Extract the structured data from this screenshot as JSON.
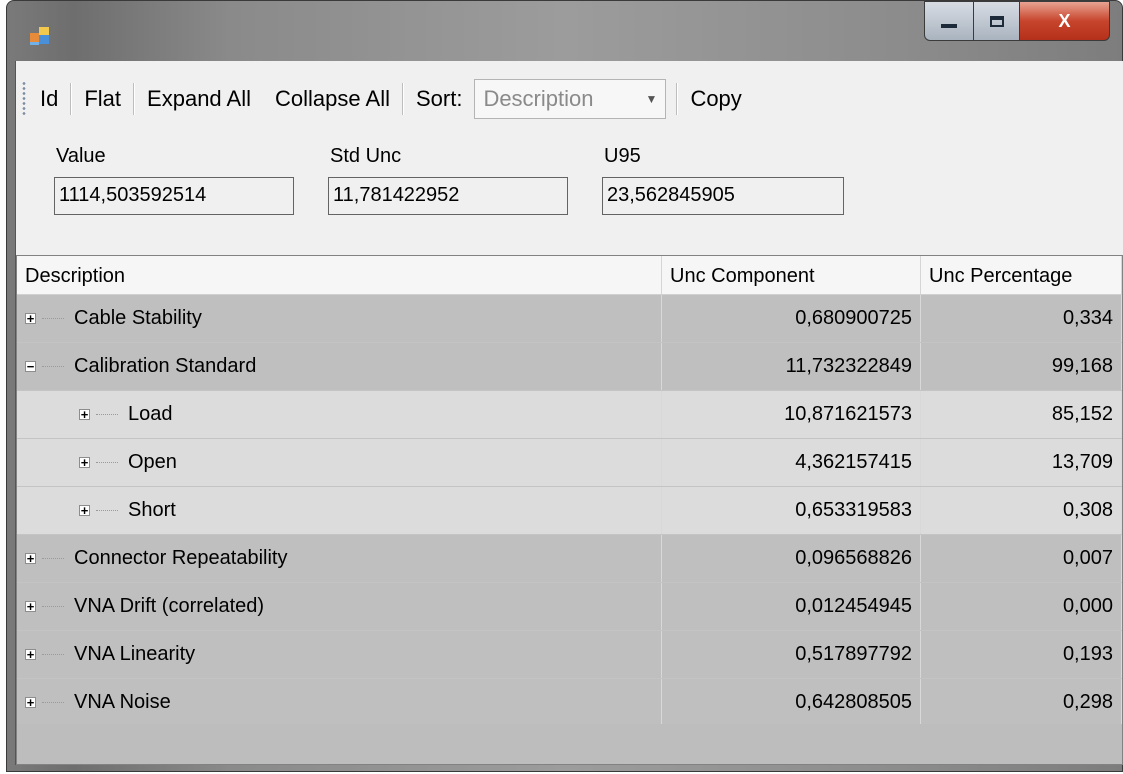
{
  "window": {
    "app_icon": "app-window-icon",
    "controls": {
      "minimize": "minimize-icon",
      "maximize": "maximize-icon",
      "close_label": "X"
    }
  },
  "toolbar": {
    "items": [
      "Id",
      "Flat",
      "Expand All",
      "Collapse All"
    ],
    "sort_label": "Sort:",
    "sort_value": "Description",
    "copy_label": "Copy"
  },
  "fields": {
    "value_label": "Value",
    "value": "1114,503592514",
    "std_unc_label": "Std Unc",
    "std_unc": "11,781422952",
    "u95_label": "U95",
    "u95": "23,562845905"
  },
  "grid": {
    "headers": [
      "Description",
      "Unc Component",
      "Unc Percentage"
    ],
    "rows": [
      {
        "level": 0,
        "expander": "+",
        "description": "Cable Stability",
        "component": "0,680900725",
        "percentage": "0,334"
      },
      {
        "level": 0,
        "expander": "−",
        "description": "Calibration Standard",
        "component": "11,732322849",
        "percentage": "99,168"
      },
      {
        "level": 1,
        "expander": "+",
        "description": "Load",
        "component": "10,871621573",
        "percentage": "85,152"
      },
      {
        "level": 1,
        "expander": "+",
        "description": "Open",
        "component": "4,362157415",
        "percentage": "13,709"
      },
      {
        "level": 1,
        "expander": "+",
        "description": "Short",
        "component": "0,653319583",
        "percentage": "0,308"
      },
      {
        "level": 0,
        "expander": "+",
        "description": "Connector Repeatability",
        "component": "0,096568826",
        "percentage": "0,007"
      },
      {
        "level": 0,
        "expander": "+",
        "description": "VNA Drift (correlated)",
        "component": "0,012454945",
        "percentage": "0,000"
      },
      {
        "level": 0,
        "expander": "+",
        "description": "VNA Linearity",
        "component": "0,517897792",
        "percentage": "0,193"
      },
      {
        "level": 0,
        "expander": "+",
        "description": "VNA Noise",
        "component": "0,642808505",
        "percentage": "0,298"
      }
    ]
  }
}
